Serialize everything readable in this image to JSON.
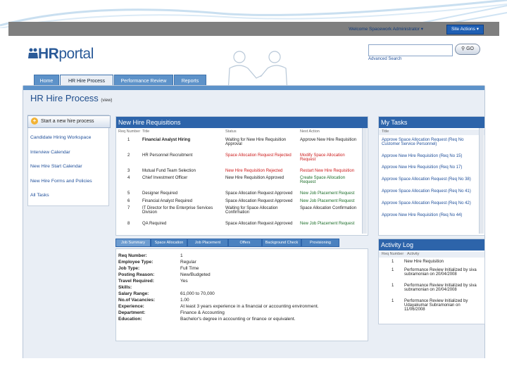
{
  "topbar": {
    "welcome": "Welcome Spacework Administrator ▾",
    "site_actions": "Site Actions ▾"
  },
  "header": {
    "logo_hr": "HR",
    "logo_portal": "portal",
    "search_placeholder": "",
    "go_label": "GO",
    "advanced_search": "Advanced Search"
  },
  "nav": {
    "tabs": [
      "Home",
      "HR Hire Process",
      "Performance Review",
      "Reports"
    ]
  },
  "page": {
    "title": "HR Hire Process",
    "title_suffix": "(view)"
  },
  "left": {
    "start_label": "Start a new hire process",
    "links": [
      "Candidate Hiring Workspace",
      "Interview Calendar",
      "New Hire Start Calendar",
      "New Hire Forms and Policies",
      "All Tasks"
    ]
  },
  "requisitions": {
    "title": "New Hire Requisitions",
    "columns": [
      "Req Number",
      "Title",
      "Status",
      "Next Action"
    ],
    "rows": [
      {
        "num": "1",
        "title": "Financial Analyst Hiring",
        "status": "Waiting for New Hire Requisition Approval",
        "action": "Approve New Hire Requisition"
      },
      {
        "num": "2",
        "title": "HR Personnel Recruitment",
        "status": "Space Allocation Request Rejected",
        "action": "Modify Space Allocation Request"
      },
      {
        "num": "3",
        "title": "Mutual Fund Team Selection",
        "status": "New Hire Requisition Rejected",
        "action": "Restart New Hire Requisition"
      },
      {
        "num": "4",
        "title": "Chief Investment Officer",
        "status": "New Hire Requisition Approved",
        "action": "Create Space Allocation Request"
      },
      {
        "num": "5",
        "title": "Designer Required",
        "status": "Space Allocation Request Approved",
        "action": "New Job Placement Request"
      },
      {
        "num": "6",
        "title": "Financial Analyst Required",
        "status": "Space Allocation Request Approved",
        "action": "New Job Placement Request"
      },
      {
        "num": "7",
        "title": "IT Director for the Enterprise Services Division",
        "status": "Waiting for Space Allocation Confirmation",
        "action": "Space Allocation Confirmation"
      },
      {
        "num": "8",
        "title": "QA Required",
        "status": "Space Allocation Request Approved",
        "action": "New Job Placement Request"
      }
    ]
  },
  "tasks": {
    "title": "My Tasks",
    "column": "Title",
    "items": [
      "Approve Space Allocation Request (Req No Customer Service Personnel)",
      "Approve New Hire Requisition (Req No 15)",
      "Approve New Hire Requisition (Req No 17)",
      "Approve Space Allocation Request (Req No 38)",
      "Approve Space Allocation Request (Req No 41)",
      "Approve Space Allocation Request (Req No 42)",
      "Approve New Hire Requisition (Req No 44)"
    ]
  },
  "subtabs": [
    "Job Summary",
    "Space Allocation",
    "Job Placement",
    "Offers",
    "Background Check",
    "Provisioning"
  ],
  "details": [
    {
      "label": "Req Number:",
      "value": "1"
    },
    {
      "label": "Employee Type:",
      "value": "Regular"
    },
    {
      "label": "Job Type:",
      "value": "Full Time"
    },
    {
      "label": "Posting Reason:",
      "value": "New/Budgeted"
    },
    {
      "label": "Travel Required:",
      "value": "Yes"
    },
    {
      "label": "Skills:",
      "value": ""
    },
    {
      "label": "Salary Range:",
      "value": "61,000 to 70,000"
    },
    {
      "label": "No.of Vacancies:",
      "value": "1.00"
    },
    {
      "label": "Experience:",
      "value": "At least 3 years experience in a financial or accounting environment."
    },
    {
      "label": "Department:",
      "value": "Finance & Accounting"
    },
    {
      "label": "Education:",
      "value": "Bachelor's degree in accounting or finance or equivalent."
    }
  ],
  "activity": {
    "title": "Activity Log",
    "columns": [
      "Req Number",
      "Activity"
    ],
    "rows": [
      {
        "num": "1",
        "text": "New Hire Requisition"
      },
      {
        "num": "1",
        "text": "Performance Review Initialized by siva subramonian on 20/04/2008"
      },
      {
        "num": "1",
        "text": "Performance Review Initialized by siva subramonian on 20/04/2008"
      },
      {
        "num": "1",
        "text": "Performance Review Initialized by Udayakumar Subramonian on 11/06/2008"
      }
    ]
  }
}
